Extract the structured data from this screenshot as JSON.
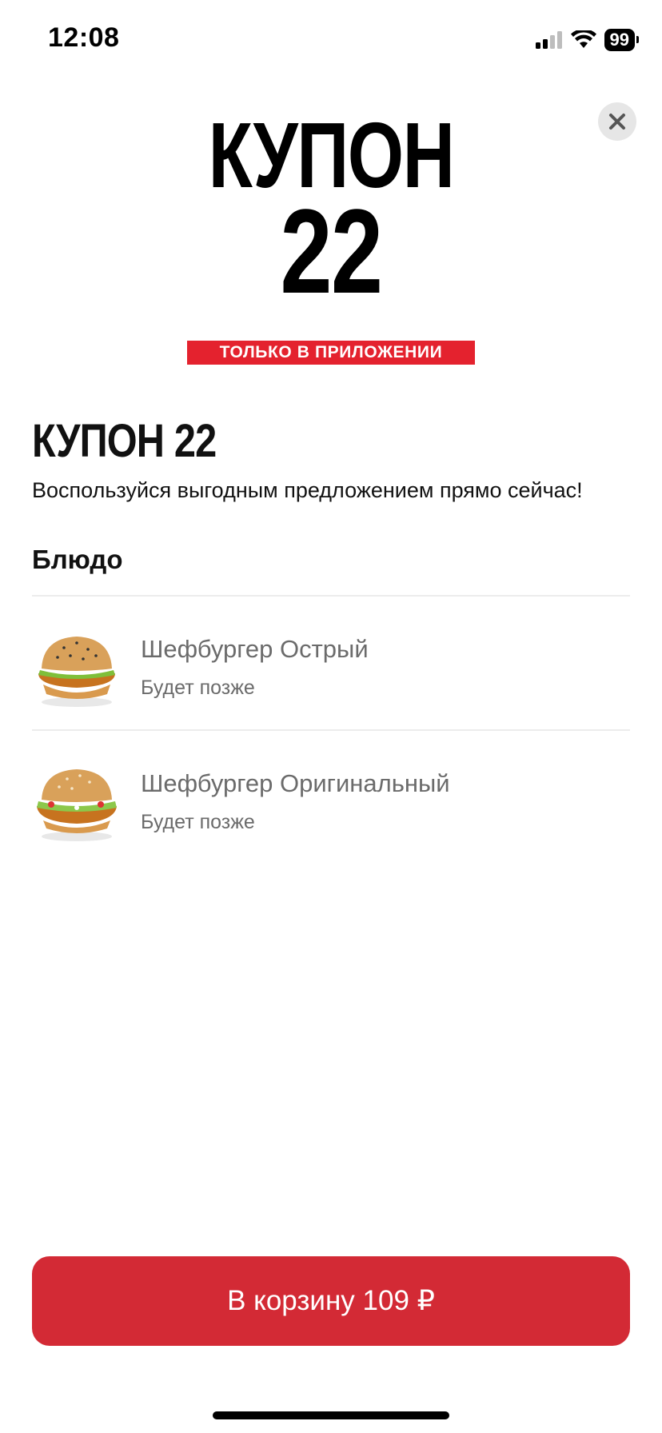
{
  "status_bar": {
    "time": "12:08",
    "battery": "99",
    "icons": [
      "cellular-signal-icon",
      "wifi-icon",
      "battery-icon"
    ]
  },
  "close_icon": "close-icon",
  "hero": {
    "line1": "КУПОН",
    "line2": "22",
    "badge": "ТОЛЬКО В ПРИЛОЖЕНИИ"
  },
  "coupon": {
    "name": "КУПОН 22",
    "description": "Воспользуйся выгодным предложением прямо сейчас!"
  },
  "section": {
    "title": "Блюдо"
  },
  "dishes": [
    {
      "name": "Шефбургер Острый",
      "status": "Будет позже"
    },
    {
      "name": "Шефбургер Оригинальный",
      "status": "Будет позже"
    }
  ],
  "cart_button": {
    "label": "В корзину 109 ₽"
  },
  "colors": {
    "accent_red": "#d32a35",
    "badge_red": "#e4222e",
    "muted_text": "#6b6b6b"
  }
}
